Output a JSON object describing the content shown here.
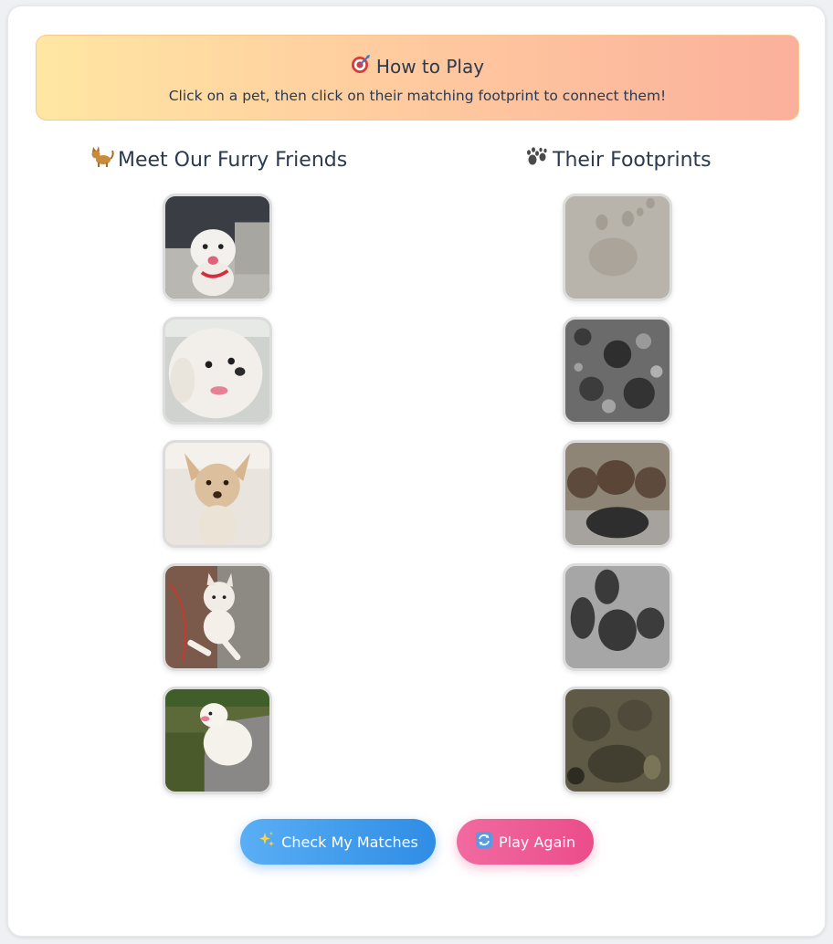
{
  "howto": {
    "title": "How to Play",
    "instructions": "Click on a pet, then click on their matching footprint to connect them!"
  },
  "pets_column": {
    "heading": "Meet Our Furry Friends",
    "pets": [
      {
        "name": "pet-1"
      },
      {
        "name": "pet-2"
      },
      {
        "name": "pet-3"
      },
      {
        "name": "pet-4"
      },
      {
        "name": "pet-5"
      }
    ]
  },
  "footprints_column": {
    "heading": "Their Footprints",
    "footprints": [
      {
        "name": "footprint-1"
      },
      {
        "name": "footprint-2"
      },
      {
        "name": "footprint-3"
      },
      {
        "name": "footprint-4"
      },
      {
        "name": "footprint-5"
      }
    ]
  },
  "buttons": {
    "check_label": "Check My Matches",
    "again_label": "Play Again"
  },
  "colors": {
    "check_button": "#2f8de4",
    "again_button": "#ec4d8a",
    "howto_gradient_start": "#ffe7a3",
    "howto_gradient_end": "#fbb09c"
  },
  "icons": {
    "howto": "target-icon",
    "pets_heading": "cat-icon",
    "footprints_heading": "paw-icon",
    "check": "sparkles-icon",
    "again": "refresh-icon"
  }
}
